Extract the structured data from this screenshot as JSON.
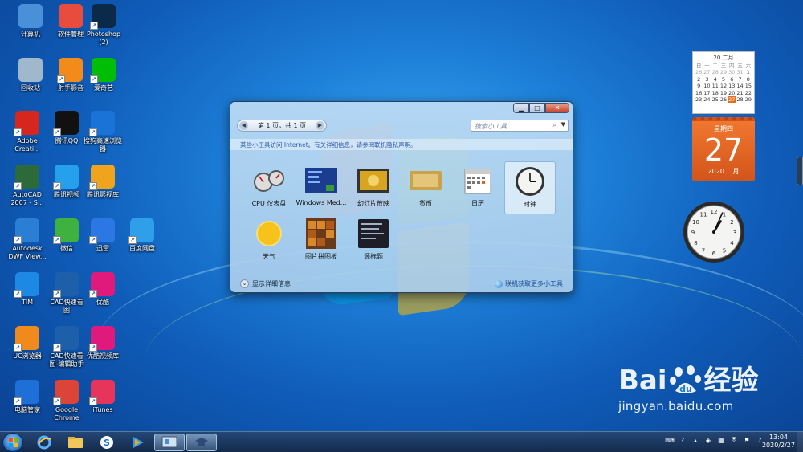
{
  "desktop": {
    "icons": [
      {
        "label": "计算机",
        "icon": "computer-icon",
        "color": "#4a90d9"
      },
      {
        "label": "软件管理",
        "icon": "software-manager-icon",
        "color": "#e84c3d"
      },
      {
        "label": "Photoshop\n(2)",
        "icon": "photoshop-icon",
        "color": "#0b2a4a"
      },
      {
        "label": "回收站",
        "icon": "recycle-bin-icon",
        "color": "#9fb8cc"
      },
      {
        "label": "射手影音",
        "icon": "shooter-player-icon",
        "color": "#f28b1a"
      },
      {
        "label": "爱奇艺",
        "icon": "iqiyi-icon",
        "color": "#00be06"
      },
      {
        "label": "Adobe\nCreati...",
        "icon": "adobe-cc-icon",
        "color": "#d7261e"
      },
      {
        "label": "腾讯QQ",
        "icon": "qq-icon",
        "color": "#111111"
      },
      {
        "label": "搜狗高速浏览\n器",
        "icon": "sogou-browser-icon",
        "color": "#1a73d6"
      },
      {
        "label": "AutoCAD\n2007 - S...",
        "icon": "autocad-icon",
        "color": "#2d6a3a"
      },
      {
        "label": "腾讯视频",
        "icon": "tencent-video-icon",
        "color": "#24a0ed"
      },
      {
        "label": "腾讯影视库",
        "icon": "tencent-library-icon",
        "color": "#f0a31d"
      },
      {
        "label": "Autodesk\nDWF View...",
        "icon": "dwf-viewer-icon",
        "color": "#2a7fd4"
      },
      {
        "label": "微信",
        "icon": "wechat-icon",
        "color": "#3eb13e"
      },
      {
        "label": "迅雷",
        "icon": "xunlei-icon",
        "color": "#2b78e4"
      },
      {
        "label": "百度网盘",
        "icon": "baidu-netdisk-icon",
        "color": "#2f9fea"
      },
      {
        "label": "TIM",
        "icon": "tim-icon",
        "color": "#1e88e5"
      },
      {
        "label": "CAD快速看\n图",
        "icon": "cad-viewer-icon",
        "color": "#1d5fa8"
      },
      {
        "label": "优酷",
        "icon": "youku-icon",
        "color": "#e0197c"
      },
      {
        "label": "UC浏览器",
        "icon": "uc-browser-icon",
        "color": "#f08a1c"
      },
      {
        "label": "CAD快速看\n图-编辑助手",
        "icon": "cad-editor-icon",
        "color": "#1d5fa8"
      },
      {
        "label": "优酷视频库",
        "icon": "youku-library-icon",
        "color": "#e0197c"
      },
      {
        "label": "电脑管家",
        "icon": "pc-manager-icon",
        "color": "#1e6fd8"
      },
      {
        "label": "Google\nChrome",
        "icon": "chrome-icon",
        "color": "#db4437"
      },
      {
        "label": "iTunes",
        "icon": "itunes-icon",
        "color": "#e6345a"
      }
    ]
  },
  "gallery": {
    "pager": "第 1 页，共 1 页",
    "search_placeholder": "搜索小工具",
    "notice": "某些小工具访问 Internet。有关详细信息，请参阅联机隐私声明。",
    "gadgets": [
      {
        "label": "CPU 仪表盘",
        "icon": "cpu-meter-icon"
      },
      {
        "label": "Windows Med...",
        "icon": "windows-media-center-icon"
      },
      {
        "label": "幻灯片放映",
        "icon": "slideshow-icon"
      },
      {
        "label": "货币",
        "icon": "currency-icon"
      },
      {
        "label": "日历",
        "icon": "calendar-icon"
      },
      {
        "label": "时钟",
        "icon": "clock-icon"
      },
      {
        "label": "天气",
        "icon": "weather-icon"
      },
      {
        "label": "图片拼图板",
        "icon": "picture-puzzle-icon"
      },
      {
        "label": "源标题",
        "icon": "feed-headlines-icon"
      }
    ],
    "details_label": "显示详细信息",
    "online_label": "联机获取更多小工具"
  },
  "calendar_gadget": {
    "month_header": "20 二月",
    "weekdays": [
      "日",
      "一",
      "二",
      "三",
      "四",
      "五",
      "六"
    ],
    "days": [
      "26",
      "27",
      "28",
      "29",
      "30",
      "31",
      "1",
      "2",
      "3",
      "4",
      "5",
      "6",
      "7",
      "8",
      "9",
      "10",
      "11",
      "12",
      "13",
      "14",
      "15",
      "16",
      "17",
      "18",
      "19",
      "20",
      "21",
      "22",
      "23",
      "24",
      "25",
      "26",
      "27",
      "28",
      "29"
    ],
    "today": "27",
    "weekday_name": "星期四",
    "day_number": "27",
    "year_month": "2020 二月"
  },
  "clock_gadget": {
    "hour": 1,
    "minute": 4
  },
  "watermark": {
    "brand_left": "Bai",
    "brand_right": "经验",
    "url": "jingyan.baidu.com"
  },
  "taskbar": {
    "time": "13:04",
    "date": "2020/2/27",
    "pinned": [
      "start-button",
      "ie-icon",
      "explorer-icon",
      "sogou-browser-icon",
      "tencent-video-icon",
      "gadget-window-icon",
      "gadget-hat-icon"
    ]
  },
  "colors": {
    "accent": "#1d7fd8",
    "calendar_orange": "#e8652a"
  }
}
